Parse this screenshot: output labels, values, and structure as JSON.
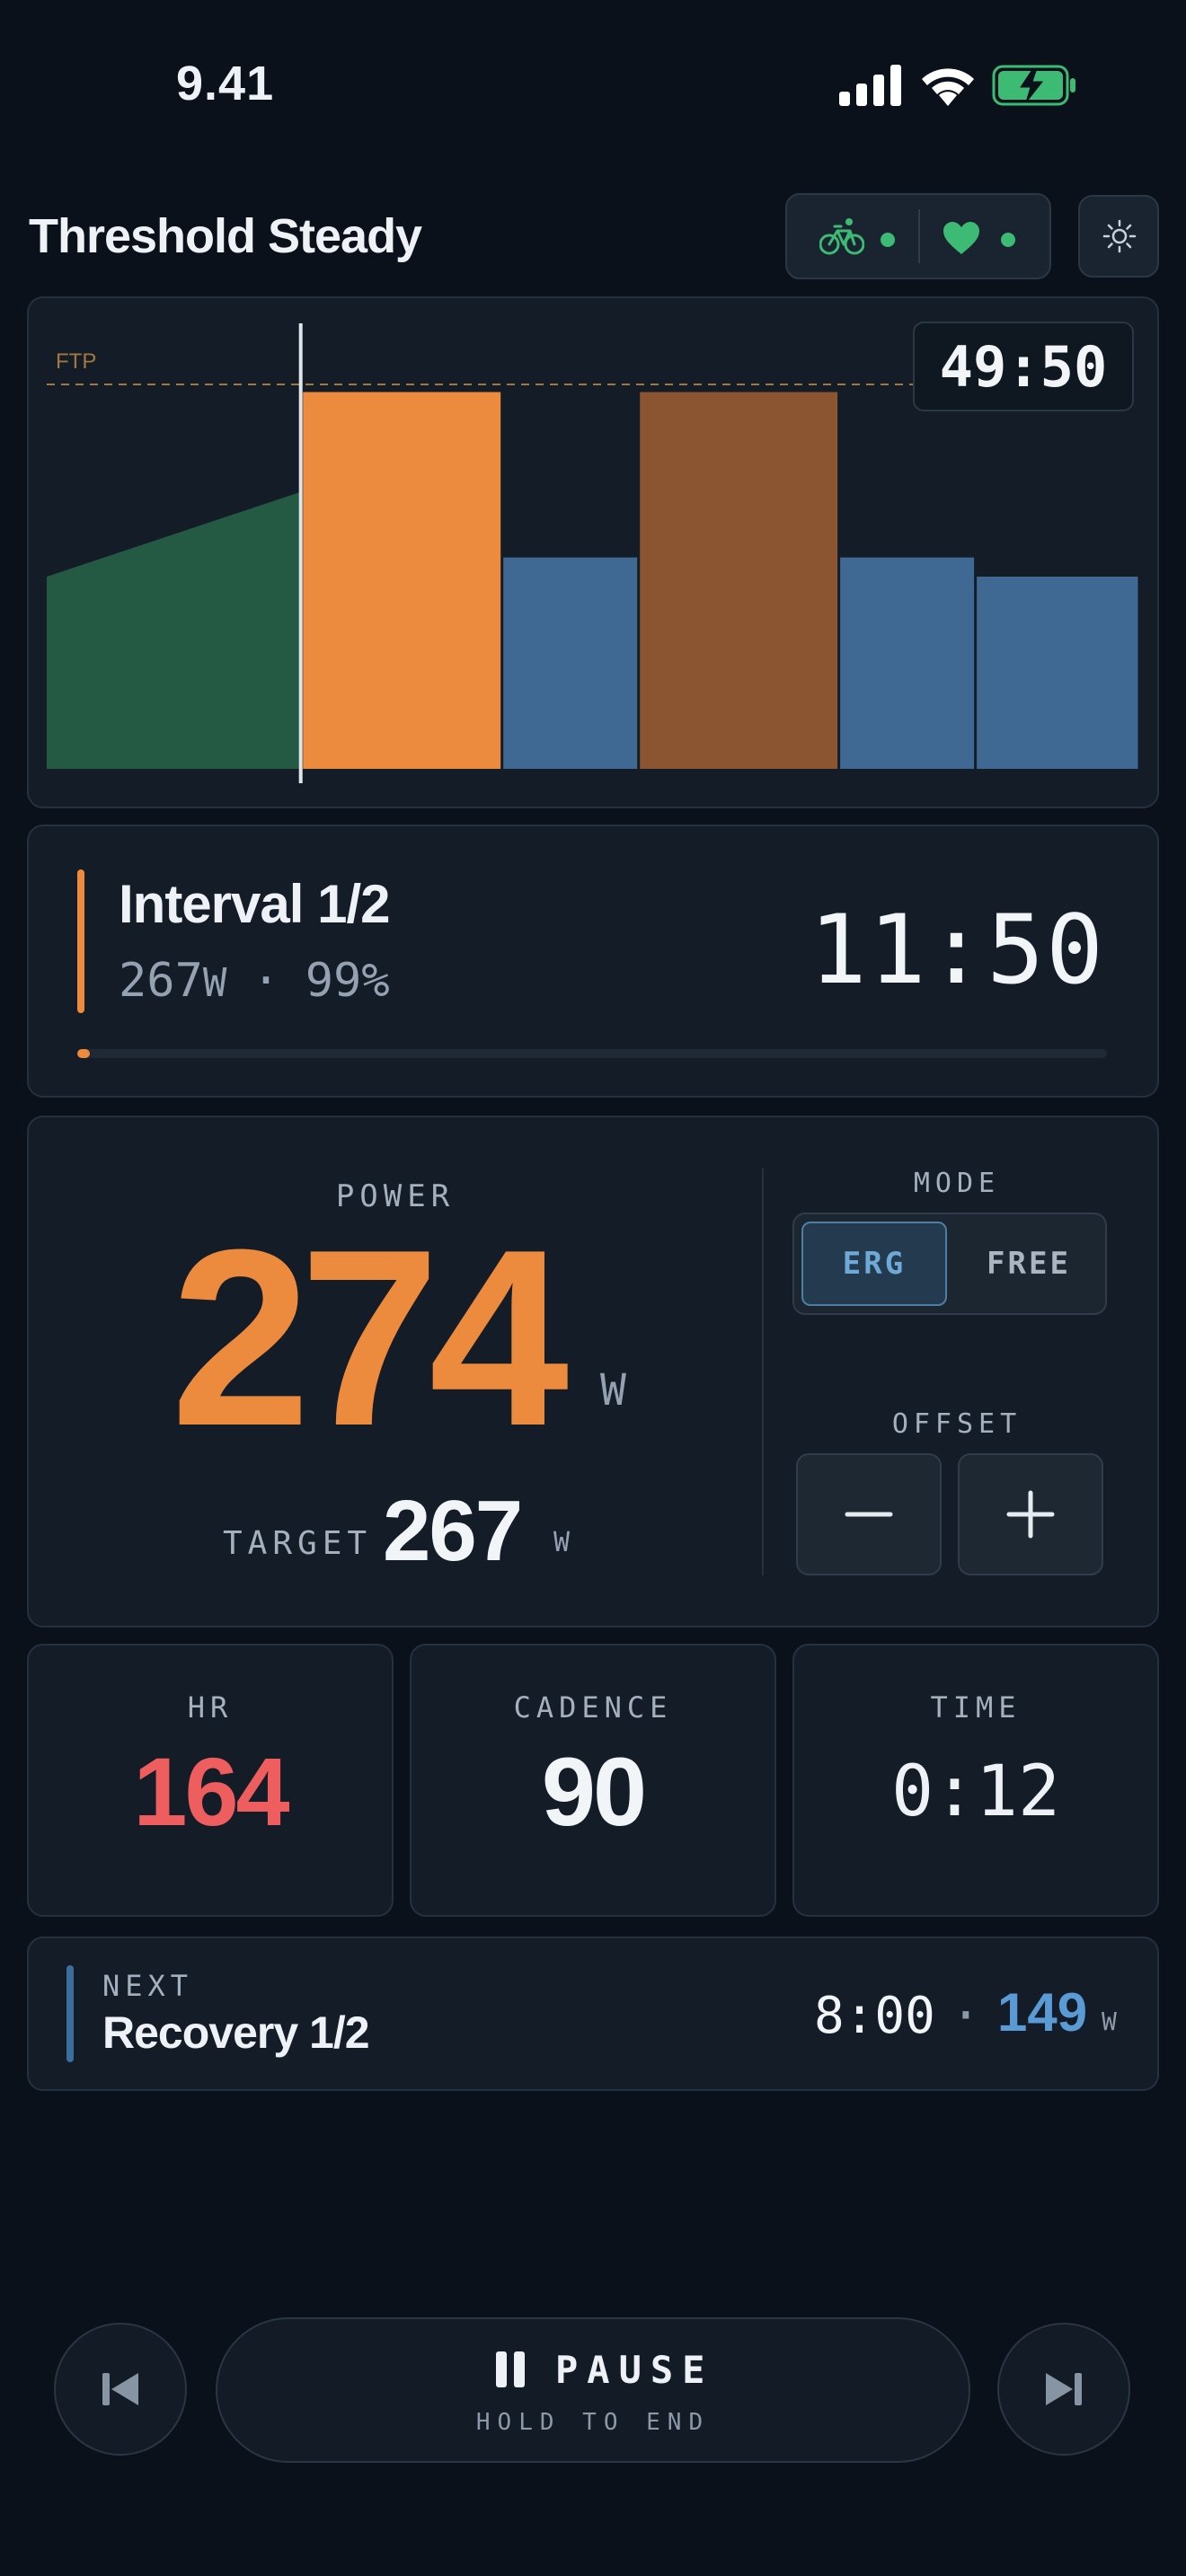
{
  "status_bar": {
    "time": "9.41"
  },
  "header": {
    "title": "Threshold Steady",
    "icons": [
      "bike-icon",
      "heart-icon",
      "brightness-icon"
    ],
    "colors": {
      "sensor": "#3dbb74"
    }
  },
  "chart": {
    "ftp_label": "FTP",
    "elapsed": "49:50",
    "segments": [
      {
        "start": 0,
        "end": 0.2333,
        "from": 0.5,
        "to": 0.72,
        "color": "#245a44"
      },
      {
        "start": 0.2333,
        "end": 0.4167,
        "from": 0.98,
        "to": 0.98,
        "color": "#ec8a3d"
      },
      {
        "start": 0.4167,
        "end": 0.5417,
        "from": 0.55,
        "to": 0.55,
        "color": "#3f6892"
      },
      {
        "start": 0.5417,
        "end": 0.725,
        "from": 0.98,
        "to": 0.98,
        "color": "#8a5530"
      },
      {
        "start": 0.725,
        "end": 0.85,
        "from": 0.55,
        "to": 0.55,
        "color": "#3f6892"
      },
      {
        "start": 0.85,
        "end": 1.0,
        "from": 0.5,
        "to": 0.5,
        "color": "#3f6892"
      }
    ],
    "ftp_level": 1.0,
    "cursor": 0.2333
  },
  "interval": {
    "title": "Interval 1/2",
    "power": "267",
    "power_unit": "W",
    "separator": "·",
    "percent": "99%",
    "remaining": "11:50",
    "progress": 0.012
  },
  "power": {
    "label": "POWER",
    "value": "274",
    "unit": "W",
    "target_label": "TARGET",
    "target_value": "267",
    "target_unit": "W",
    "mode_label": "MODE",
    "mode_erg": "ERG",
    "mode_free": "FREE",
    "selected_mode": "ERG",
    "offset_label": "OFFSET",
    "offset_minus": "−",
    "offset_plus": "+"
  },
  "metrics": [
    {
      "label": "HR",
      "value": "164",
      "color": "#ee5e5e"
    },
    {
      "label": "CADENCE",
      "value": "90",
      "color": "#f2f5f8"
    },
    {
      "label": "TIME",
      "value": "0:12",
      "color": "#f2f5f8"
    }
  ],
  "next": {
    "label": "NEXT",
    "name": "Recovery 1/2",
    "duration": "8:00",
    "separator": "·",
    "power": "149",
    "unit": "W"
  },
  "controls": {
    "pause_label": "PAUSE",
    "pause_hint": "HOLD TO END"
  }
}
